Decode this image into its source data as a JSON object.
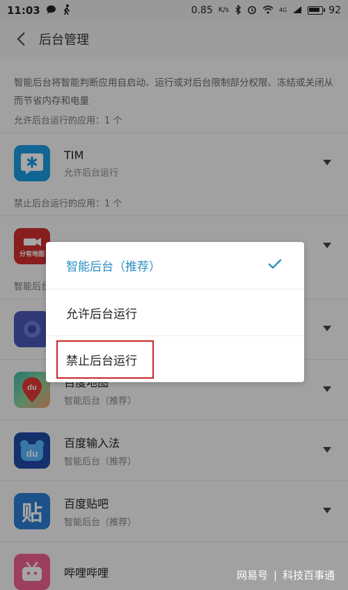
{
  "status_bar": {
    "time": "11:03",
    "network_speed": "0.85",
    "speed_unit": "K/s",
    "network_type": "4G",
    "battery": 92,
    "icons": [
      "chat-icon",
      "walk-icon",
      "bluetooth-icon",
      "alarm-icon",
      "wifi-icon",
      "signal-icon",
      "battery-icon"
    ]
  },
  "app_bar": {
    "title": "后台管理"
  },
  "description": "智能后台将智能判断应用自启动、运行或对后台限制部分权限、冻结或关闭从而节省内存和电量",
  "sections": {
    "allowed": "允许后台运行的应用：1 个",
    "forbidden": "禁止后台运行的应用：1 个",
    "smart": "智能后台"
  },
  "apps": [
    {
      "name": "TIM",
      "status": "允许后台运行",
      "icon": "tim-icon",
      "color": "#1a9be0"
    },
    {
      "name": "分有地图",
      "status": "",
      "icon": "map-camera-icon",
      "color": "#d32f2f"
    },
    {
      "name": "",
      "status": "",
      "icon": "app-icon",
      "color": "#4a56b8"
    },
    {
      "name": "百度地图",
      "status": "智能后台（推荐）",
      "icon": "baidu-map-icon",
      "color": "#3cb9a8"
    },
    {
      "name": "百度输入法",
      "status": "智能后台（推荐）",
      "icon": "baidu-input-icon",
      "color": "#2a6fd6"
    },
    {
      "name": "百度贴吧",
      "status": "智能后台（推荐）",
      "icon": "tieba-icon",
      "color": "#2b7dd4"
    },
    {
      "name": "哔哩哔哩",
      "status": "",
      "icon": "bilibili-icon",
      "color": "#f06292"
    }
  ],
  "dialog": {
    "options": [
      {
        "label": "智能后台（推荐）",
        "selected": true
      },
      {
        "label": "允许后台运行",
        "selected": false
      },
      {
        "label": "禁止后台运行",
        "selected": false
      }
    ]
  },
  "icon_glyphs": {
    "map": "分有地图",
    "baidu_map": "du",
    "baidu_input": "du",
    "tieba": "贴"
  },
  "watermark": {
    "brand": "网易号",
    "separator": "|",
    "account": "科技百事通"
  }
}
